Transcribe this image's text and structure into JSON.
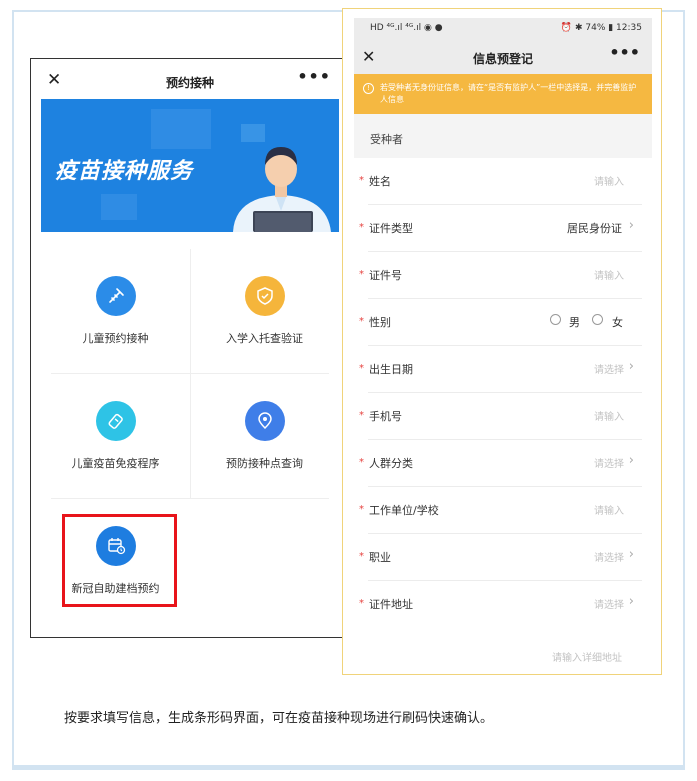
{
  "left_phone": {
    "title": "预约接种",
    "close_glyph": "✕",
    "more_glyph": "•••",
    "banner_text": "疫苗接种服务",
    "menu": [
      {
        "label": "儿童预约接种",
        "icon": "syringe-icon",
        "color": "#2b8ce8"
      },
      {
        "label": "入学入托查验证",
        "icon": "shield-icon",
        "color": "#f5b53b"
      },
      {
        "label": "儿童疫苗免疫程序",
        "icon": "vaccine-icon",
        "color": "#2ec3e6"
      },
      {
        "label": "预防接种点查询",
        "icon": "location-icon",
        "color": "#3f7ee8"
      },
      {
        "label": "新冠自助建档预约",
        "icon": "calendar-clock-icon",
        "color": "#1e7de0"
      }
    ]
  },
  "right_phone": {
    "status_left": "HD ⁴ᴳ.ıl ⁴ᴳ.ıl ◉ ●",
    "status_right": "⏰ ✱ 74% ▮ 12:35",
    "title": "信息预登记",
    "close_glyph": "✕",
    "more_glyph": "•••",
    "notice": "若受种者无身份证信息，请在“是否有监护人”一栏中选择是，并完善监护人信息",
    "section_title": "受种者",
    "fields": [
      {
        "label": "姓名",
        "placeholder": "请输入"
      },
      {
        "label": "证件类型",
        "value": "居民身份证"
      },
      {
        "label": "证件号",
        "placeholder": "请输入"
      },
      {
        "label": "性别",
        "options": [
          "男",
          "女"
        ]
      },
      {
        "label": "出生日期",
        "placeholder": "请选择"
      },
      {
        "label": "手机号",
        "placeholder": "请输入"
      },
      {
        "label": "人群分类",
        "placeholder": "请选择"
      },
      {
        "label": "工作单位/学校",
        "placeholder": "请输入"
      },
      {
        "label": "职业",
        "placeholder": "请选择"
      },
      {
        "label": "证件地址",
        "placeholder": "请选择"
      }
    ],
    "address_placeholder": "请输入详细地址",
    "required_mark": "*",
    "chevron": "›"
  },
  "caption": "按要求填写信息，生成条形码界面，可在疫苗接种现场进行刷码快速确认。",
  "colors": {
    "accent": "#1e82e0",
    "notice": "#f5b841",
    "highlight": "#e8141a",
    "required": "#e64340"
  }
}
